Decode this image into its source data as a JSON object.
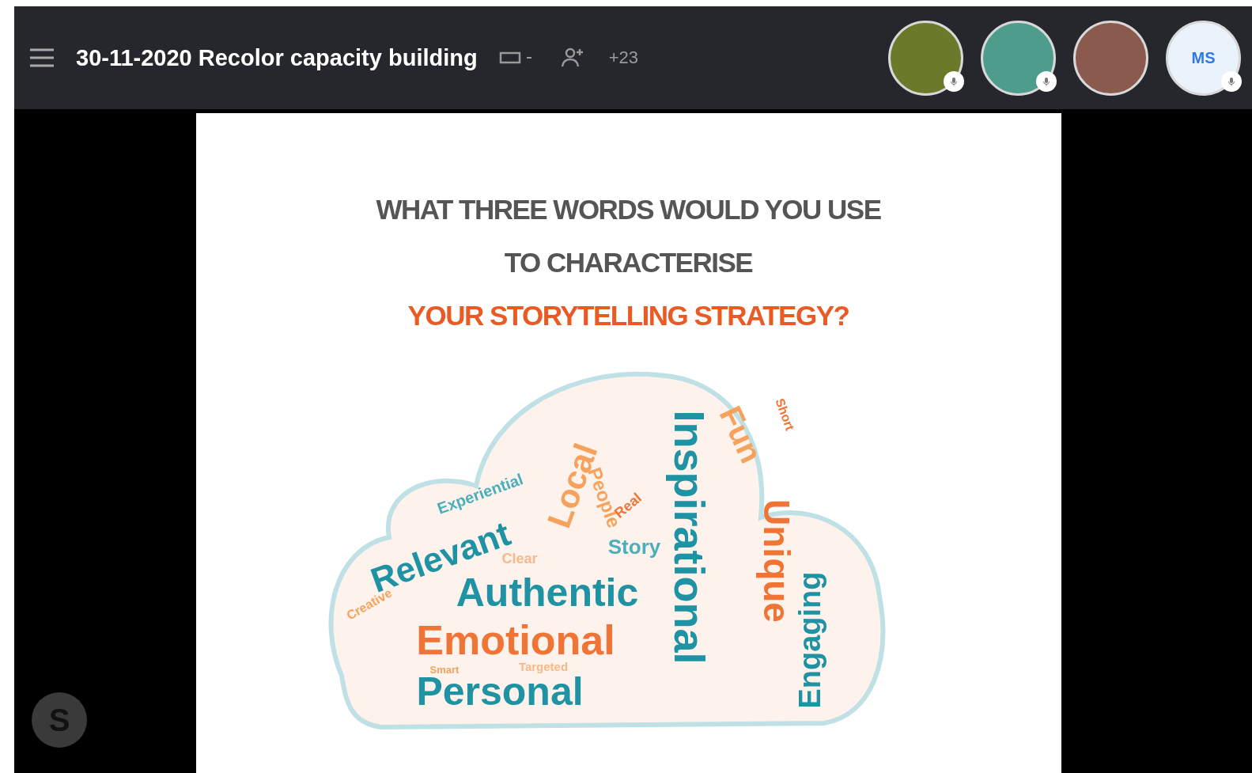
{
  "header": {
    "title": "30-11-2020 Recolor capacity building",
    "extra_participants": "+23",
    "participants": [
      {
        "kind": "landscape",
        "mic": true
      },
      {
        "kind": "photo",
        "mic": true
      },
      {
        "kind": "portrait",
        "mic": false
      },
      {
        "kind": "initials",
        "initials": "MS",
        "mic": true
      }
    ]
  },
  "slide": {
    "title_lines": [
      {
        "text": "WHAT THREE WORDS WOULD YOU USE",
        "color": "#555555"
      },
      {
        "text": "TO CHARACTERISE",
        "color": "#555555"
      },
      {
        "text": "YOUR STORYTELLING STRATEGY?",
        "color": "#ea5a24"
      }
    ],
    "words": [
      {
        "text": "Relevant",
        "color": "#1f93a3"
      },
      {
        "text": "Authentic",
        "color": "#1f93a3"
      },
      {
        "text": "Emotional",
        "color": "#f07435"
      },
      {
        "text": "Personal",
        "color": "#1f93a3"
      },
      {
        "text": "Inspirational",
        "color": "#1f93a3"
      },
      {
        "text": "Unique",
        "color": "#f07435"
      },
      {
        "text": "Fun",
        "color": "#f7a25c"
      },
      {
        "text": "Local",
        "color": "#f7a25c"
      },
      {
        "text": "People",
        "color": "#f7a25c"
      },
      {
        "text": "Story",
        "color": "#4aaebb"
      },
      {
        "text": "Experiential",
        "color": "#4aaebb"
      },
      {
        "text": "Engaging",
        "color": "#1f93a3"
      },
      {
        "text": "Clear",
        "color": "#f7b88a"
      },
      {
        "text": "Creative",
        "color": "#f7a25c"
      },
      {
        "text": "Short",
        "color": "#f07435"
      },
      {
        "text": "Real",
        "color": "#f07435"
      },
      {
        "text": "Smart",
        "color": "#f7a25c"
      },
      {
        "text": "Targeted",
        "color": "#f7b88a"
      }
    ]
  },
  "app_logo": "S"
}
